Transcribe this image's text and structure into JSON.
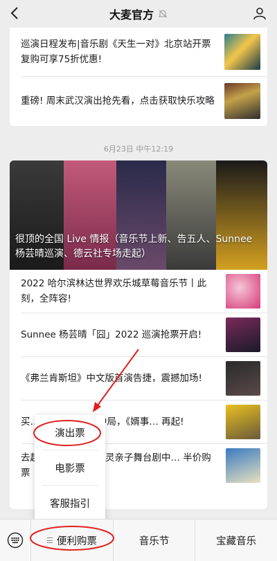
{
  "header": {
    "title": "大麦官方"
  },
  "card1": {
    "items": [
      {
        "text": "巡演日程发布|音乐剧《天生一对》北京站开票 复购可享75折优惠!"
      },
      {
        "text": "重磅! 周末武汉演出抢先看，点击获取快乐攻略"
      }
    ]
  },
  "timestamp": "6月23日 中午12:19",
  "card2": {
    "hero_caption": "很顶的全国 Live 情报（音乐节上新、告五人、Sunnee 杨芸晴巡演、德云社专场走起）",
    "items": [
      {
        "text": "2022 哈尔滨林达世界欢乐城草莓音乐节丨此刻，全阵容!"
      },
      {
        "text": "Sunnee 杨芸晴「囧」2022 巡演抢票开启!"
      },
      {
        "text": "《弗兰肯斯坦》中文版首演告捷，震撼加场!"
      },
      {
        "text": "买… 800场爆笑局中局，《婿事… 再起!"
      },
      {
        "text": "去超… 吧! ——蓝精灵亲子舞台剧中… 半价购票"
      }
    ]
  },
  "menu": {
    "items": [
      "演出票",
      "电影票",
      "客服指引"
    ]
  },
  "bottombar": {
    "tabs": [
      "便利购票",
      "音乐节",
      "宝藏音乐"
    ]
  },
  "colors": {
    "annotation": "#e02020",
    "accent_festival": "#d63a7a"
  }
}
